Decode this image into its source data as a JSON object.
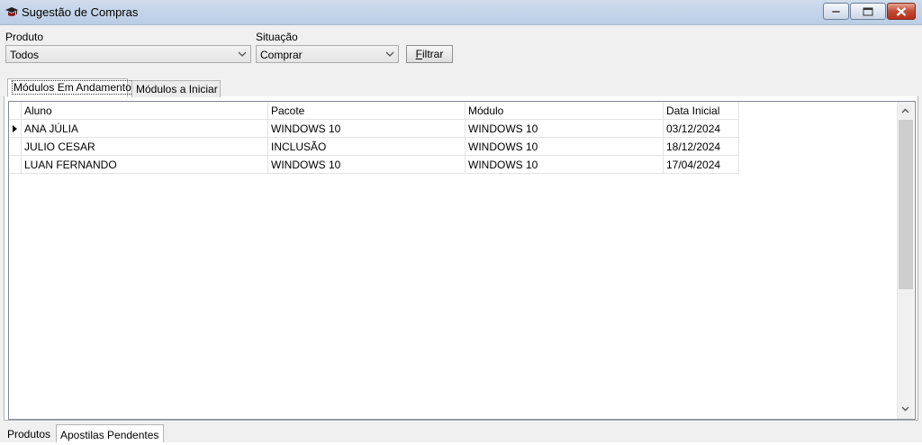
{
  "window": {
    "title": "Sugestão de Compras",
    "icon": "app-hat-icon",
    "controls": [
      "minimize-icon",
      "maximize-icon",
      "close-icon"
    ]
  },
  "filters": {
    "produto_label": "Produto",
    "produto_value": "Todos",
    "situacao_label": "Situação",
    "situacao_value": "Comprar",
    "filter_button_label_accel": "F",
    "filter_button_label_rest": "iltrar"
  },
  "tabs": [
    {
      "label": "Módulos Em Andamento",
      "active": true
    },
    {
      "label": "Módulos a Iniciar",
      "active": false
    }
  ],
  "grid": {
    "columns": [
      "Aluno",
      "Pacote",
      "Módulo",
      "Data Inicial"
    ],
    "rows": [
      [
        "ANA JÚLIA",
        "WINDOWS 10",
        "WINDOWS 10",
        "03/12/2024"
      ],
      [
        "JULIO CESAR",
        "INCLUSÃO",
        "WINDOWS 10",
        "18/12/2024"
      ],
      [
        "LUAN FERNANDO",
        "WINDOWS 10",
        "WINDOWS 10",
        "17/04/2024"
      ]
    ],
    "current_row": 0
  },
  "bottom_tabs": [
    {
      "label": "Produtos",
      "active": false
    },
    {
      "label": "Apostilas Pendentes",
      "active": true
    }
  ],
  "colors": {
    "titlebar": "#b9cde5",
    "close_button": "#c34a33",
    "window_bg": "#f0f0f0"
  }
}
